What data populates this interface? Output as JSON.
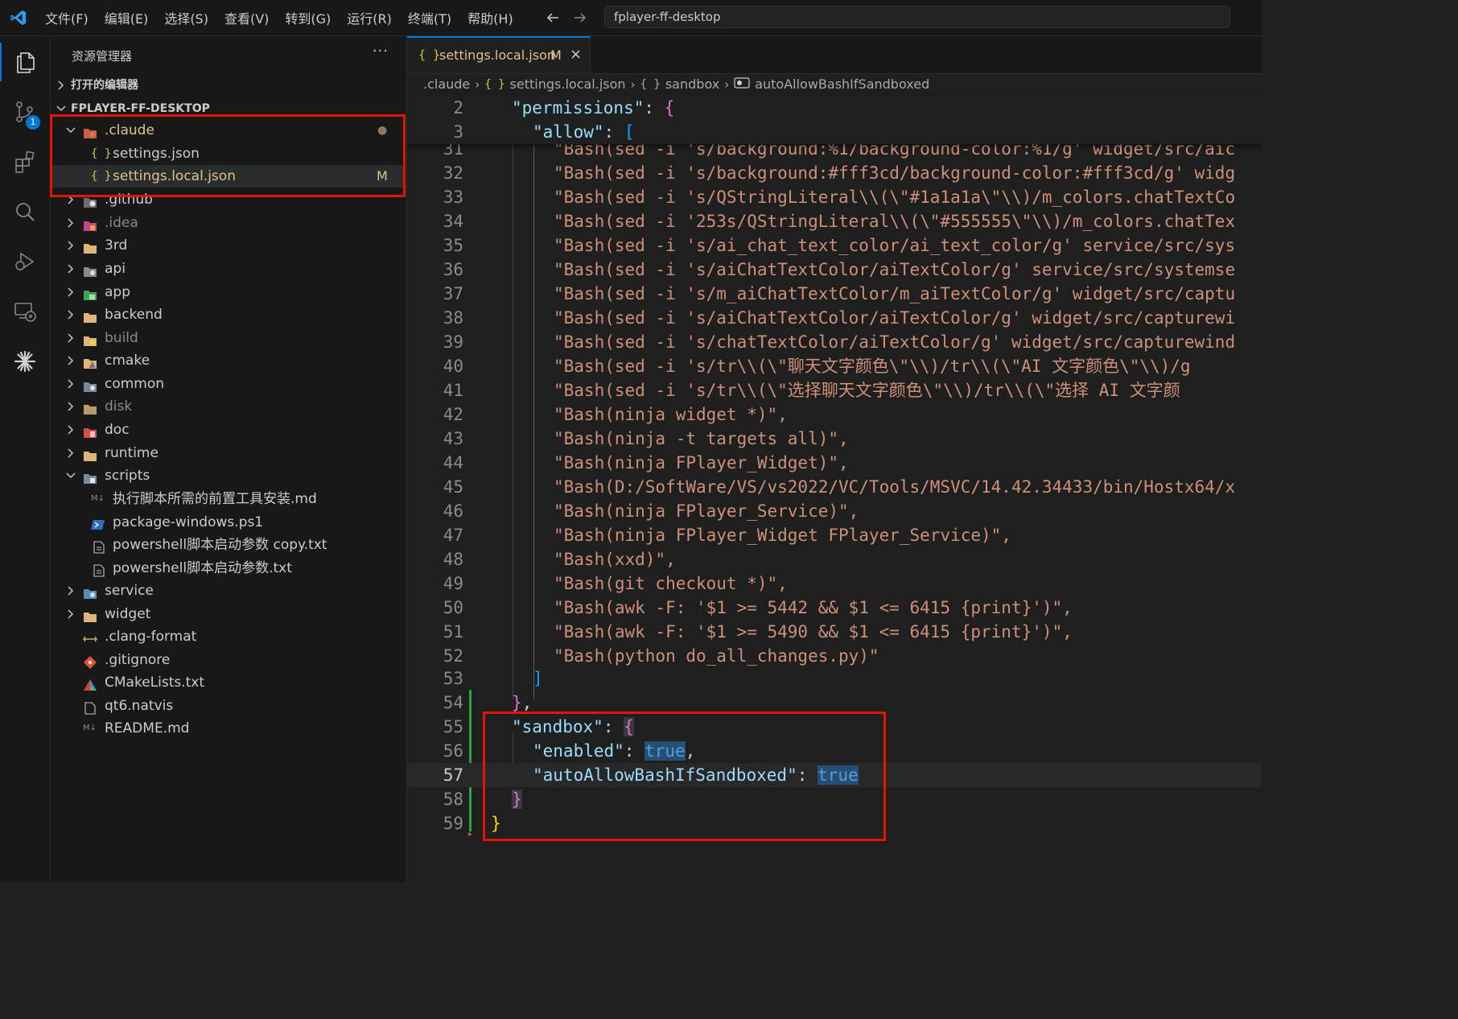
{
  "titlebar": {
    "menus": [
      "文件(F)",
      "编辑(E)",
      "选择(S)",
      "查看(V)",
      "转到(G)",
      "运行(R)",
      "终端(T)",
      "帮助(H)"
    ],
    "command_center": "fplayer-ff-desktop"
  },
  "activity": {
    "scm_badge": "1"
  },
  "sidebar": {
    "title": "资源管理器",
    "more": "···",
    "open_editors": "打开的编辑器",
    "workspace": "FPLAYER-FF-DESKTOP",
    "items": [
      {
        "label": ".claude",
        "status": "●"
      },
      {
        "label": "settings.json"
      },
      {
        "label": "settings.local.json",
        "status": "M"
      },
      {
        "label": ".github"
      },
      {
        "label": ".idea"
      },
      {
        "label": "3rd"
      },
      {
        "label": "api"
      },
      {
        "label": "app"
      },
      {
        "label": "backend"
      },
      {
        "label": "build"
      },
      {
        "label": "cmake"
      },
      {
        "label": "common"
      },
      {
        "label": "disk"
      },
      {
        "label": "doc"
      },
      {
        "label": "runtime"
      },
      {
        "label": "scripts"
      },
      {
        "label": "执行脚本所需的前置工具安装.md"
      },
      {
        "label": "package-windows.ps1"
      },
      {
        "label": "powershell脚本启动参数 copy.txt"
      },
      {
        "label": "powershell脚本启动参数.txt"
      },
      {
        "label": "service"
      },
      {
        "label": "widget"
      },
      {
        "label": ".clang-format"
      },
      {
        "label": ".gitignore"
      },
      {
        "label": "CMakeLists.txt"
      },
      {
        "label": "qt6.natvis"
      },
      {
        "label": "README.md"
      }
    ]
  },
  "tab": {
    "icon": "{ }",
    "name": "settings.local.json",
    "modified": "M",
    "close": "×"
  },
  "breadcrumb": {
    "parts": [
      ".claude",
      "settings.local.json",
      "sandbox",
      "autoAllowBashIfSandboxed"
    ],
    "obj_icon": "{ }"
  },
  "code": {
    "sticky": [
      {
        "no": "2",
        "indent": "  ",
        "key": "\"permissions\"",
        "sep": ": ",
        "brace": "{"
      },
      {
        "no": "3",
        "indent": "    ",
        "key": "\"allow\"",
        "sep": ": ",
        "brace": "["
      }
    ],
    "lines": [
      {
        "no": "31",
        "text": "\"Bash(sed -i 's/background:%1/background-color:%1/g' widget/src/aic"
      },
      {
        "no": "32",
        "text": "\"Bash(sed -i 's/background:#fff3cd/background-color:#fff3cd/g' widg"
      },
      {
        "no": "33",
        "text": "\"Bash(sed -i 's/QStringLiteral\\\\(\\\"#1a1a1a\\\"\\\\)/m_colors.chatTextCo"
      },
      {
        "no": "34",
        "text": "\"Bash(sed -i '253s/QStringLiteral\\\\(\\\"#555555\\\"\\\\)/m_colors.chatTex"
      },
      {
        "no": "35",
        "text": "\"Bash(sed -i 's/ai_chat_text_color/ai_text_color/g' service/src/sys"
      },
      {
        "no": "36",
        "text": "\"Bash(sed -i 's/aiChatTextColor/aiTextColor/g' service/src/systemse"
      },
      {
        "no": "37",
        "text": "\"Bash(sed -i 's/m_aiChatTextColor/m_aiTextColor/g' widget/src/captu"
      },
      {
        "no": "38",
        "text": "\"Bash(sed -i 's/aiChatTextColor/aiTextColor/g' widget/src/capturewi"
      },
      {
        "no": "39",
        "text": "\"Bash(sed -i 's/chatTextColor/aiTextColor/g' widget/src/capturewind"
      },
      {
        "no": "40",
        "text": "\"Bash(sed -i 's/tr\\\\(\\\"聊天文字颜色\\\"\\\\)/tr\\\\(\\\"AI 文字颜色\\\"\\\\)/g"
      },
      {
        "no": "41",
        "text": "\"Bash(sed -i 's/tr\\\\(\\\"选择聊天文字颜色\\\"\\\\)/tr\\\\(\\\"选择 AI 文字颜"
      },
      {
        "no": "42",
        "text": "\"Bash(ninja widget *)\","
      },
      {
        "no": "43",
        "text": "\"Bash(ninja -t targets all)\","
      },
      {
        "no": "44",
        "text": "\"Bash(ninja FPlayer_Widget)\","
      },
      {
        "no": "45",
        "text": "\"Bash(D:/SoftWare/VS/vs2022/VC/Tools/MSVC/14.42.34433/bin/Hostx64/x"
      },
      {
        "no": "46",
        "text": "\"Bash(ninja FPlayer_Service)\","
      },
      {
        "no": "47",
        "text": "\"Bash(ninja FPlayer_Widget FPlayer_Service)\","
      },
      {
        "no": "48",
        "text": "\"Bash(xxd)\","
      },
      {
        "no": "49",
        "text": "\"Bash(git checkout *)\","
      },
      {
        "no": "50",
        "text": "\"Bash(awk -F: '$1 >= 5442 && $1 <= 6415 {print}')\","
      },
      {
        "no": "51",
        "text": "\"Bash(awk -F: '$1 >= 5490 && $1 <= 6415 {print}')\","
      },
      {
        "no": "52",
        "text": "\"Bash(python do_all_changes.py)\""
      }
    ],
    "l53": {
      "no": "53",
      "brace": "]"
    },
    "l54": {
      "no": "54",
      "brace": "}",
      "comma": ","
    },
    "l55": {
      "no": "55",
      "key": "\"sandbox\"",
      "sep": ": ",
      "brace": "{"
    },
    "l56": {
      "no": "56",
      "key": "\"enabled\"",
      "sep": ": ",
      "val": "true",
      "comma": ","
    },
    "l57": {
      "no": "57",
      "key": "\"autoAllowBashIfSandboxed\"",
      "sep": ": ",
      "val": "true"
    },
    "l58": {
      "no": "58",
      "brace": "}"
    },
    "l59": {
      "no": "59",
      "brace": "}"
    }
  },
  "colors": {
    "accent": "#0078d4",
    "highlight_box": "#e51400",
    "modified": "#e2c08d",
    "added_gutter": "#2ea043"
  }
}
